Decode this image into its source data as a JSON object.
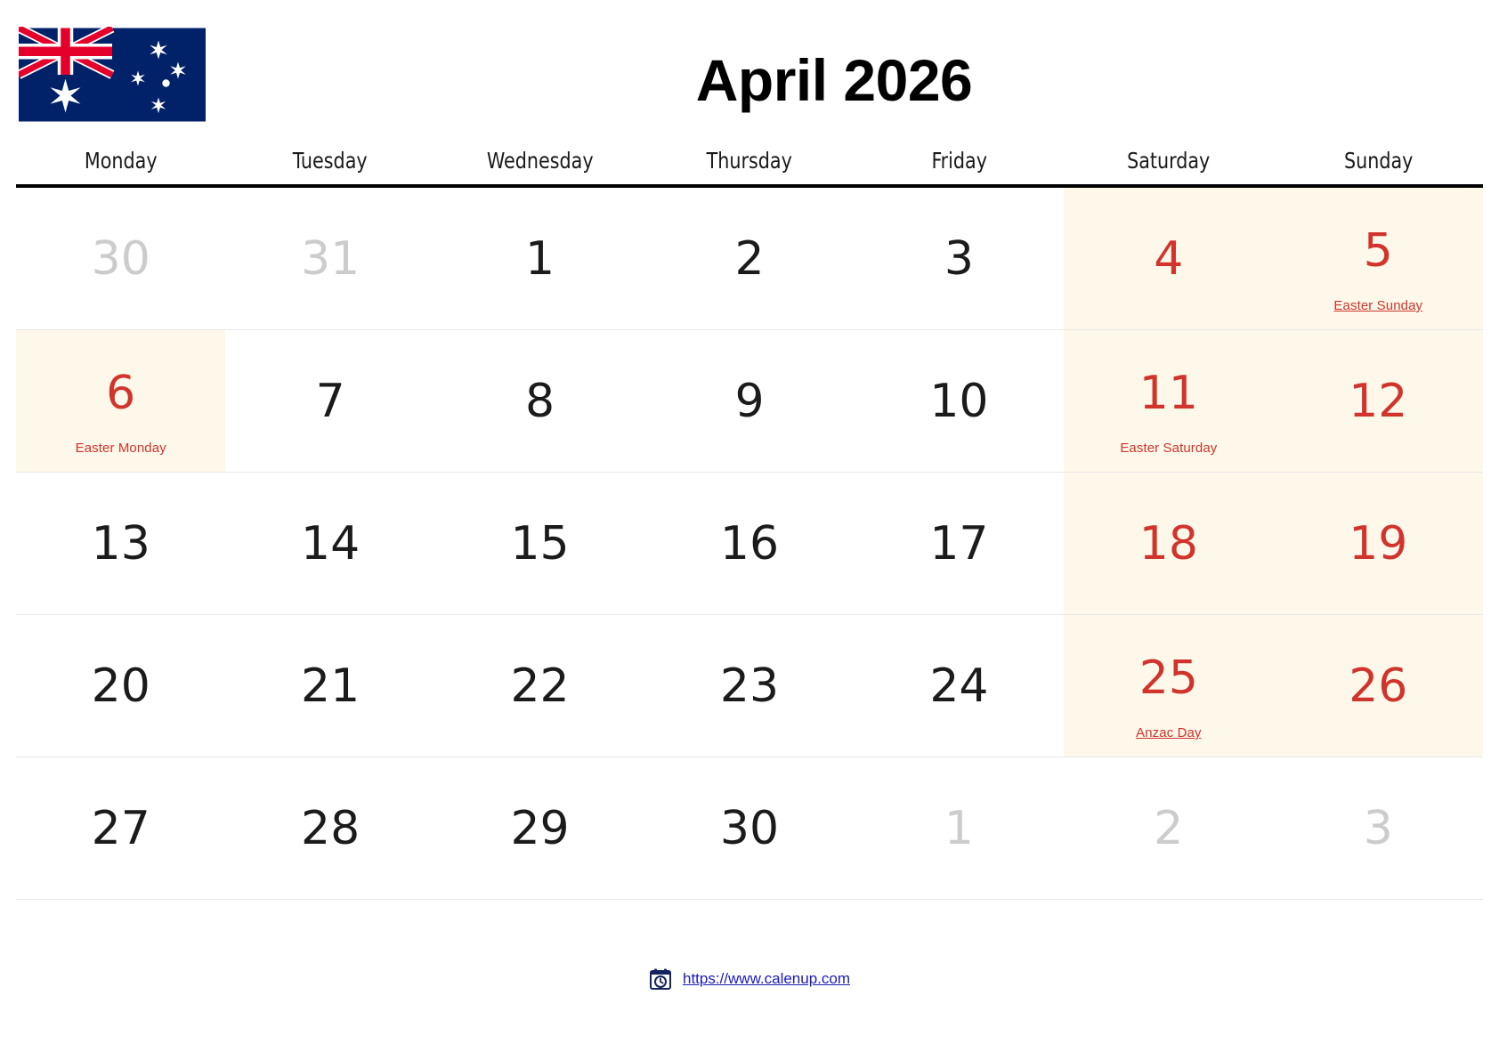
{
  "header": {
    "title": "April 2026",
    "flag_icon": "australia-flag",
    "flag_colors": {
      "navy": "#012169",
      "red": "#E4002B",
      "white": "#FFFFFF"
    }
  },
  "colors": {
    "holiday_red": "#D0342C",
    "weekend_bg": "#FDF8EA",
    "muted_day": "#CCCCCC",
    "header_rule": "#000000",
    "link_blue": "#1A1AB8"
  },
  "weekdays": [
    "Monday",
    "Tuesday",
    "Wednesday",
    "Thursday",
    "Friday",
    "Saturday",
    "Sunday"
  ],
  "weeks": [
    [
      {
        "num": "30",
        "muted": true,
        "red": false,
        "weekend": false,
        "holiday": ""
      },
      {
        "num": "31",
        "muted": true,
        "red": false,
        "weekend": false,
        "holiday": ""
      },
      {
        "num": "1",
        "muted": false,
        "red": false,
        "weekend": false,
        "holiday": ""
      },
      {
        "num": "2",
        "muted": false,
        "red": false,
        "weekend": false,
        "holiday": ""
      },
      {
        "num": "3",
        "muted": false,
        "red": false,
        "weekend": false,
        "holiday": ""
      },
      {
        "num": "4",
        "muted": false,
        "red": true,
        "weekend": true,
        "holiday": ""
      },
      {
        "num": "5",
        "muted": false,
        "red": true,
        "weekend": true,
        "holiday": "Easter Sunday",
        "underline": true
      }
    ],
    [
      {
        "num": "6",
        "muted": false,
        "red": true,
        "weekend": false,
        "holiday": "Easter Monday",
        "underline": false,
        "highlight": true
      },
      {
        "num": "7",
        "muted": false,
        "red": false,
        "weekend": false,
        "holiday": ""
      },
      {
        "num": "8",
        "muted": false,
        "red": false,
        "weekend": false,
        "holiday": ""
      },
      {
        "num": "9",
        "muted": false,
        "red": false,
        "weekend": false,
        "holiday": ""
      },
      {
        "num": "10",
        "muted": false,
        "red": false,
        "weekend": false,
        "holiday": ""
      },
      {
        "num": "11",
        "muted": false,
        "red": true,
        "weekend": true,
        "holiday": "Easter Saturday",
        "underline": false
      },
      {
        "num": "12",
        "muted": false,
        "red": true,
        "weekend": true,
        "holiday": ""
      }
    ],
    [
      {
        "num": "13",
        "muted": false,
        "red": false,
        "weekend": false,
        "holiday": ""
      },
      {
        "num": "14",
        "muted": false,
        "red": false,
        "weekend": false,
        "holiday": ""
      },
      {
        "num": "15",
        "muted": false,
        "red": false,
        "weekend": false,
        "holiday": ""
      },
      {
        "num": "16",
        "muted": false,
        "red": false,
        "weekend": false,
        "holiday": ""
      },
      {
        "num": "17",
        "muted": false,
        "red": false,
        "weekend": false,
        "holiday": ""
      },
      {
        "num": "18",
        "muted": false,
        "red": true,
        "weekend": true,
        "holiday": ""
      },
      {
        "num": "19",
        "muted": false,
        "red": true,
        "weekend": true,
        "holiday": ""
      }
    ],
    [
      {
        "num": "20",
        "muted": false,
        "red": false,
        "weekend": false,
        "holiday": ""
      },
      {
        "num": "21",
        "muted": false,
        "red": false,
        "weekend": false,
        "holiday": ""
      },
      {
        "num": "22",
        "muted": false,
        "red": false,
        "weekend": false,
        "holiday": ""
      },
      {
        "num": "23",
        "muted": false,
        "red": false,
        "weekend": false,
        "holiday": ""
      },
      {
        "num": "24",
        "muted": false,
        "red": false,
        "weekend": false,
        "holiday": ""
      },
      {
        "num": "25",
        "muted": false,
        "red": true,
        "weekend": true,
        "holiday": "Anzac Day",
        "underline": true
      },
      {
        "num": "26",
        "muted": false,
        "red": true,
        "weekend": true,
        "holiday": ""
      }
    ],
    [
      {
        "num": "27",
        "muted": false,
        "red": false,
        "weekend": false,
        "holiday": ""
      },
      {
        "num": "28",
        "muted": false,
        "red": false,
        "weekend": false,
        "holiday": ""
      },
      {
        "num": "29",
        "muted": false,
        "red": false,
        "weekend": false,
        "holiday": ""
      },
      {
        "num": "30",
        "muted": false,
        "red": false,
        "weekend": false,
        "holiday": ""
      },
      {
        "num": "1",
        "muted": true,
        "red": false,
        "weekend": false,
        "holiday": ""
      },
      {
        "num": "2",
        "muted": true,
        "red": false,
        "weekend": false,
        "holiday": ""
      },
      {
        "num": "3",
        "muted": true,
        "red": false,
        "weekend": false,
        "holiday": ""
      }
    ]
  ],
  "footer": {
    "icon": "calendar-clock-icon",
    "url": "https://www.calenup.com"
  }
}
